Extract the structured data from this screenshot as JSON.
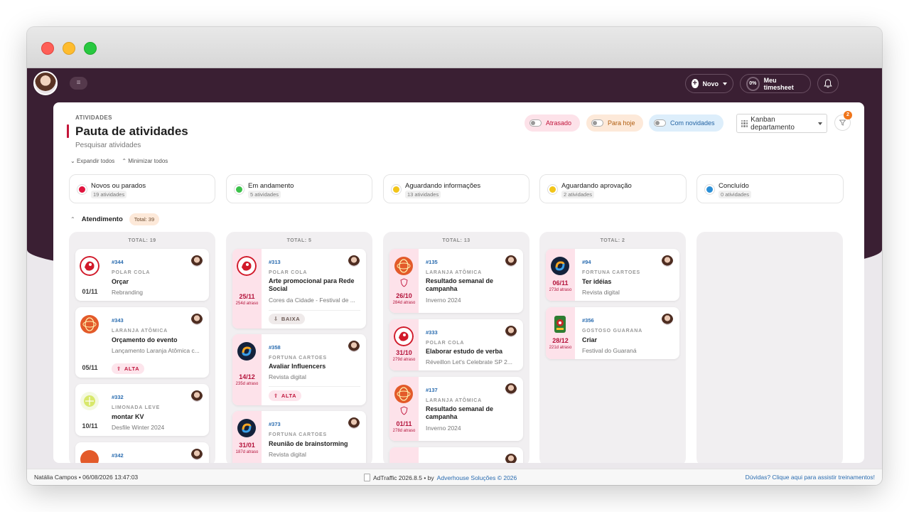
{
  "window": {
    "controls": [
      "close",
      "minimize",
      "maximize"
    ]
  },
  "header": {
    "menu_icon": "≡",
    "novo_label": "Novo",
    "timesheet_percent": "0%",
    "timesheet_label": "Meu timesheet",
    "bell_icon": "bell-icon"
  },
  "page": {
    "breadcrumb": "ATIVIDADES",
    "title": "Pauta de atividades",
    "search_placeholder": "Pesquisar atividades",
    "expand_all": "Expandir todos",
    "minimize_all": "Minimizar todos"
  },
  "filters": {
    "atrasado": "Atrasado",
    "hoje": "Para hoje",
    "novidades": "Com novidades",
    "kanban_select": "Kanban departamento",
    "filter_badge": "2"
  },
  "statuses": [
    {
      "label": "Novos ou parados",
      "count": "19 atividades",
      "color": "#e0143e"
    },
    {
      "label": "Em andamento",
      "count": "5 atividades",
      "color": "#3cc24b"
    },
    {
      "label": "Aguardando informações",
      "count": "13 atividades",
      "color": "#f2c51a"
    },
    {
      "label": "Aguardando aprovação",
      "count": "2 atividades",
      "color": "#f2c51a"
    },
    {
      "label": "Concluído",
      "count": "0 atividades",
      "color": "#2b8fd6"
    }
  ],
  "group": {
    "name": "Atendimento",
    "total": "Total: 39"
  },
  "columns": [
    {
      "total": "TOTAL: 19",
      "cards": [
        {
          "num": "#344",
          "client": "POLAR COLA",
          "title": "Orçar",
          "subtitle": "Rebranding",
          "date": "01/11",
          "delay": "",
          "priority": ""
        },
        {
          "num": "#343",
          "client": "LARANJA ATÔMICA",
          "title": "Orçamento do evento",
          "subtitle": "Lançamento Laranja Atômica c...",
          "date": "05/11",
          "delay": "",
          "priority": "ALTA"
        },
        {
          "num": "#332",
          "client": "LIMONADA LEVE",
          "title": "montar KV",
          "subtitle": "Desfile Winter 2024",
          "date": "10/11",
          "delay": "",
          "priority": ""
        },
        {
          "num": "#342",
          "client": "",
          "title": "",
          "subtitle": "",
          "date": "",
          "delay": "",
          "priority": ""
        }
      ]
    },
    {
      "total": "TOTAL: 5",
      "cards": [
        {
          "num": "#313",
          "client": "POLAR COLA",
          "title": "Arte promocional para Rede Social",
          "subtitle": "Cores da Cidade - Festival de ...",
          "date": "25/11",
          "delay": "254d atraso",
          "priority": "BAIXA"
        },
        {
          "num": "#358",
          "client": "FORTUNA CARTOES",
          "title": "Avaliar Influencers",
          "subtitle": "Revista digital",
          "date": "14/12",
          "delay": "235d atraso",
          "priority": "ALTA"
        },
        {
          "num": "#373",
          "client": "FORTUNA CARTOES",
          "title": "Reunião de brainstorming",
          "subtitle": "Revista digital",
          "date": "31/01",
          "delay": "187d atraso",
          "priority": ""
        }
      ]
    },
    {
      "total": "TOTAL: 13",
      "cards": [
        {
          "num": "#135",
          "client": "LARANJA ATÔMICA",
          "title": "Resultado semanal de campanha",
          "subtitle": "Inverno 2024",
          "date": "26/10",
          "delay": "284d atraso",
          "priority": ""
        },
        {
          "num": "#333",
          "client": "POLAR COLA",
          "title": "Elaborar estudo de verba",
          "subtitle": "Réveillon Let's Celebrate SP 2...",
          "date": "31/10",
          "delay": "279d atraso",
          "priority": ""
        },
        {
          "num": "#137",
          "client": "LARANJA ATÔMICA",
          "title": "Resultado semanal de campanha",
          "subtitle": "Inverno 2024",
          "date": "01/11",
          "delay": "278d atraso",
          "priority": ""
        }
      ]
    },
    {
      "total": "TOTAL: 2",
      "cards": [
        {
          "num": "#94",
          "client": "FORTUNA CARTOES",
          "title": "Ter idéias",
          "subtitle": "Revista digital",
          "date": "06/11",
          "delay": "273d atraso",
          "priority": ""
        },
        {
          "num": "#356",
          "client": "GOSTOSO GUARANA",
          "title": "Criar",
          "subtitle": "Festival do Guaraná",
          "date": "28/12",
          "delay": "221d atraso",
          "priority": ""
        }
      ]
    },
    {
      "total": "",
      "cards": []
    }
  ],
  "footer": {
    "user_info": "Natália Campos • 06/08/2026 13:47:03",
    "app_version": "AdTraffic 2026.8.5 • by",
    "company_link": "Adverhouse Soluções © 2026",
    "help_link": "Dúvidas? Clique aqui para assistir treinamentos!"
  }
}
